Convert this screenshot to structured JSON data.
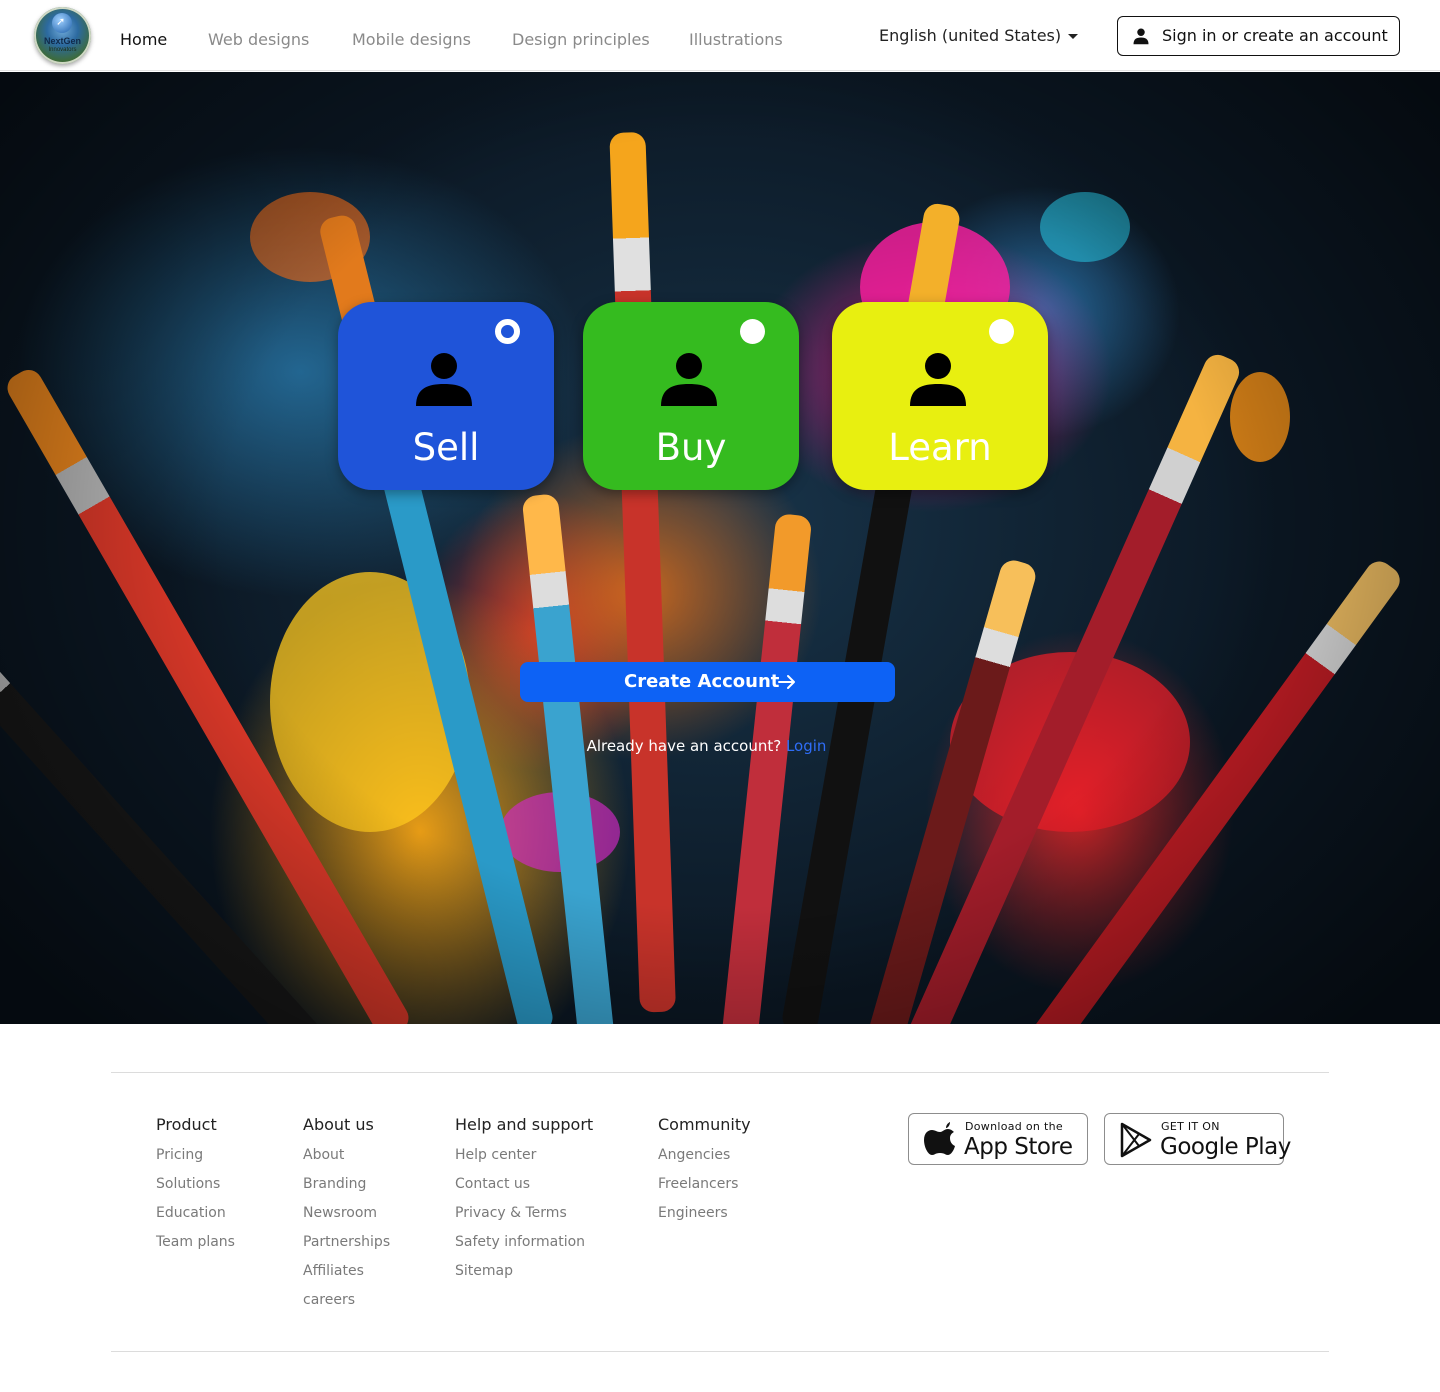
{
  "header": {
    "logo": {
      "text": "NextGen",
      "subtext": "Innovators",
      "icon": "globe-arrow-icon"
    },
    "nav": [
      {
        "label": "Home",
        "active": true
      },
      {
        "label": "Web designs",
        "active": false
      },
      {
        "label": "Mobile designs",
        "active": false
      },
      {
        "label": "Design principles",
        "active": false
      },
      {
        "label": "Illustrations",
        "active": false
      }
    ],
    "language": {
      "label": "English (united States)",
      "icon": "caret-down-icon"
    },
    "signin": {
      "label": "Sign in or create an account",
      "icon": "user-icon"
    }
  },
  "hero": {
    "background": "paint-brushes-splash-image",
    "cards": [
      {
        "label": "Sell",
        "color": "#1f54d9",
        "selected": true,
        "icon": "user-icon"
      },
      {
        "label": "Buy",
        "color": "#35bb1f",
        "selected": false,
        "icon": "user-icon"
      },
      {
        "label": "Learn",
        "color": "#e8ef10",
        "selected": false,
        "icon": "user-icon"
      }
    ],
    "cta": {
      "label": "Create Account",
      "icon": "arrow-right-icon",
      "color": "#0d62f5"
    },
    "login_prompt": {
      "text": "Already have an account?",
      "link": "Login",
      "link_color": "#2f6df6"
    }
  },
  "footer": {
    "columns": [
      {
        "heading": "Product",
        "links": [
          "Pricing",
          "Solutions",
          "Education",
          "Team plans"
        ]
      },
      {
        "heading": "About us",
        "links": [
          "About",
          "Branding",
          "Newsroom",
          "Partnerships",
          "Affiliates",
          "careers"
        ]
      },
      {
        "heading": "Help and support",
        "links": [
          "Help center",
          "Contact us",
          "Privacy & Terms",
          "Safety information",
          "Sitemap"
        ]
      },
      {
        "heading": "Community",
        "links": [
          "Angencies",
          "Freelancers",
          "Engineers"
        ]
      }
    ],
    "stores": [
      {
        "small": "Download on the",
        "big": "App Store",
        "icon": "apple-icon"
      },
      {
        "small": "GET IT ON",
        "big": "Google Play",
        "icon": "play-store-icon"
      }
    ]
  }
}
